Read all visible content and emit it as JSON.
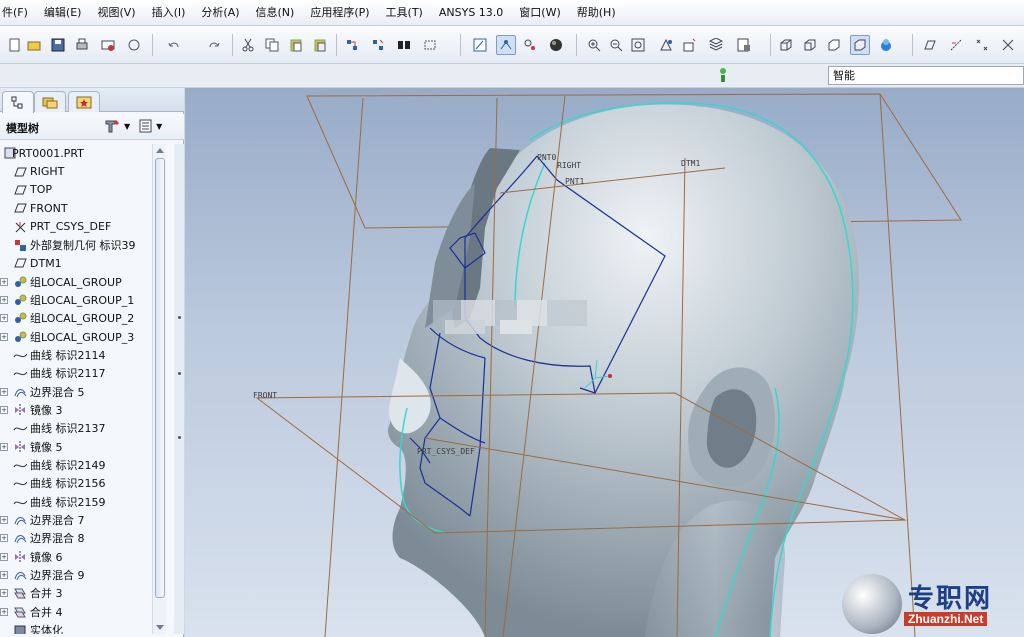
{
  "menu": [
    "件(F)",
    "编辑(E)",
    "视图(V)",
    "插入(I)",
    "分析(A)",
    "信息(N)",
    "应用程序(P)",
    "工具(T)",
    "ANSYS 13.0",
    "窗口(W)",
    "帮助(H)"
  ],
  "toolbar": {
    "icons": [
      "new-icon",
      "open-icon",
      "save-icon",
      "print-icon",
      "send-mail-icon",
      "regenerate-icon",
      "undo-icon",
      "redo-icon",
      "cut-icon",
      "copy-icon",
      "paste-icon",
      "paste-special-icon",
      "regen-icon",
      "regen-manager-icon",
      "find-icon",
      "select-box-icon",
      "repaint-icon",
      "spin-center-icon",
      "orient-icon",
      "shading-sphere-icon",
      "zoom-in-icon",
      "zoom-out-icon",
      "refit-icon",
      "view-reorient-icon",
      "saved-views-icon",
      "layers-icon",
      "view-manager-icon",
      "wireframe-icon",
      "hidden-line-icon",
      "no-hidden-icon",
      "shaded-icon",
      "enhanced-realism-icon",
      "datum-plane-display-icon",
      "datum-axis-display-icon",
      "datum-point-display-icon",
      "csys-display-icon"
    ]
  },
  "filter": {
    "value": "智能"
  },
  "tree": {
    "title": "模型树",
    "items": [
      {
        "label": "PRT0001.PRT",
        "icon": "part-icon",
        "expand": false,
        "root": true
      },
      {
        "label": "RIGHT",
        "icon": "datum-plane-icon",
        "expand": false
      },
      {
        "label": "TOP",
        "icon": "datum-plane-icon",
        "expand": false
      },
      {
        "label": "FRONT",
        "icon": "datum-plane-icon",
        "expand": false
      },
      {
        "label": "PRT_CSYS_DEF",
        "icon": "csys-icon",
        "expand": false
      },
      {
        "label": "外部复制几何 标识39",
        "icon": "external-copy-geom-icon",
        "expand": false
      },
      {
        "label": "DTM1",
        "icon": "datum-plane-icon",
        "expand": false
      },
      {
        "label": "组LOCAL_GROUP",
        "icon": "group-icon",
        "expand": true
      },
      {
        "label": "组LOCAL_GROUP_1",
        "icon": "group-icon",
        "expand": true
      },
      {
        "label": "组LOCAL_GROUP_2",
        "icon": "group-icon",
        "expand": true
      },
      {
        "label": "组LOCAL_GROUP_3",
        "icon": "group-icon",
        "expand": true
      },
      {
        "label": "曲线 标识2114",
        "icon": "curve-icon",
        "expand": false
      },
      {
        "label": "曲线 标识2117",
        "icon": "curve-icon",
        "expand": false
      },
      {
        "label": "边界混合 5",
        "icon": "boundary-blend-icon",
        "expand": true
      },
      {
        "label": "镜像 3",
        "icon": "mirror-icon",
        "expand": true
      },
      {
        "label": "曲线 标识2137",
        "icon": "curve-icon",
        "expand": false
      },
      {
        "label": "镜像 5",
        "icon": "mirror-icon",
        "expand": true
      },
      {
        "label": "曲线 标识2149",
        "icon": "curve-icon",
        "expand": false
      },
      {
        "label": "曲线 标识2156",
        "icon": "curve-icon",
        "expand": false
      },
      {
        "label": "曲线 标识2159",
        "icon": "curve-icon",
        "expand": false
      },
      {
        "label": "边界混合 7",
        "icon": "boundary-blend-icon",
        "expand": true
      },
      {
        "label": "边界混合 8",
        "icon": "boundary-blend-icon",
        "expand": true
      },
      {
        "label": "镜像 6",
        "icon": "mirror-icon",
        "expand": true
      },
      {
        "label": "边界混合 9",
        "icon": "boundary-blend-icon",
        "expand": true
      },
      {
        "label": "合并 3",
        "icon": "merge-icon",
        "expand": true
      },
      {
        "label": "合并 4",
        "icon": "merge-icon",
        "expand": true
      },
      {
        "label": "实体化",
        "icon": "solidify-icon",
        "expand": false
      }
    ]
  },
  "viewport": {
    "labels": {
      "right": "RIGHT",
      "pnt0": "PNT0",
      "pnt1": "PNT1",
      "dtm1": "DTM1",
      "front": "FRONT",
      "csys": "PRT_CSYS_DEF"
    }
  },
  "watermark": {
    "cn": "专职网",
    "en": "Zhuanzhi.Net"
  },
  "colors": {
    "datum": "#a06a3c",
    "curve": "#1b2f99",
    "edge": "#36d7d0",
    "surface": "#b9c6cf"
  }
}
